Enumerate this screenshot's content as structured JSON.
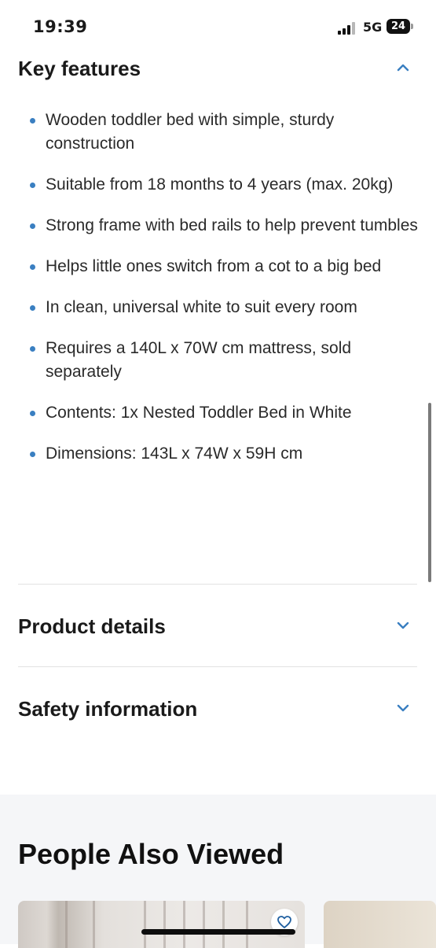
{
  "status_bar": {
    "time": "19:39",
    "network": "5G",
    "battery": "24"
  },
  "sections": {
    "key_features": {
      "title": "Key features",
      "state": "expanded",
      "items": [
        "Wooden toddler bed with simple, sturdy construction",
        "Suitable from 18 months to 4 years (max. 20kg)",
        "Strong frame with bed rails to help prevent tumbles",
        "Helps little ones switch from a cot to a big bed",
        "In clean, universal white to suit every room",
        "Requires a 140L x 70W cm mattress, sold separately",
        "Contents: 1x Nested Toddler Bed in White",
        "Dimensions: 143L x 74W x 59H cm"
      ]
    },
    "product_details": {
      "title": "Product details",
      "state": "collapsed"
    },
    "safety_information": {
      "title": "Safety information",
      "state": "collapsed"
    }
  },
  "people_also_viewed": {
    "title": "People Also Viewed"
  },
  "icons": {
    "collapse": "chevron-up-icon",
    "expand": "chevron-down-icon",
    "favorite": "heart-icon"
  },
  "colors": {
    "accent": "#3a7fc1",
    "text": "#1a1a1a",
    "divider": "#e2e2e2",
    "section_bg": "#f5f6f8"
  }
}
